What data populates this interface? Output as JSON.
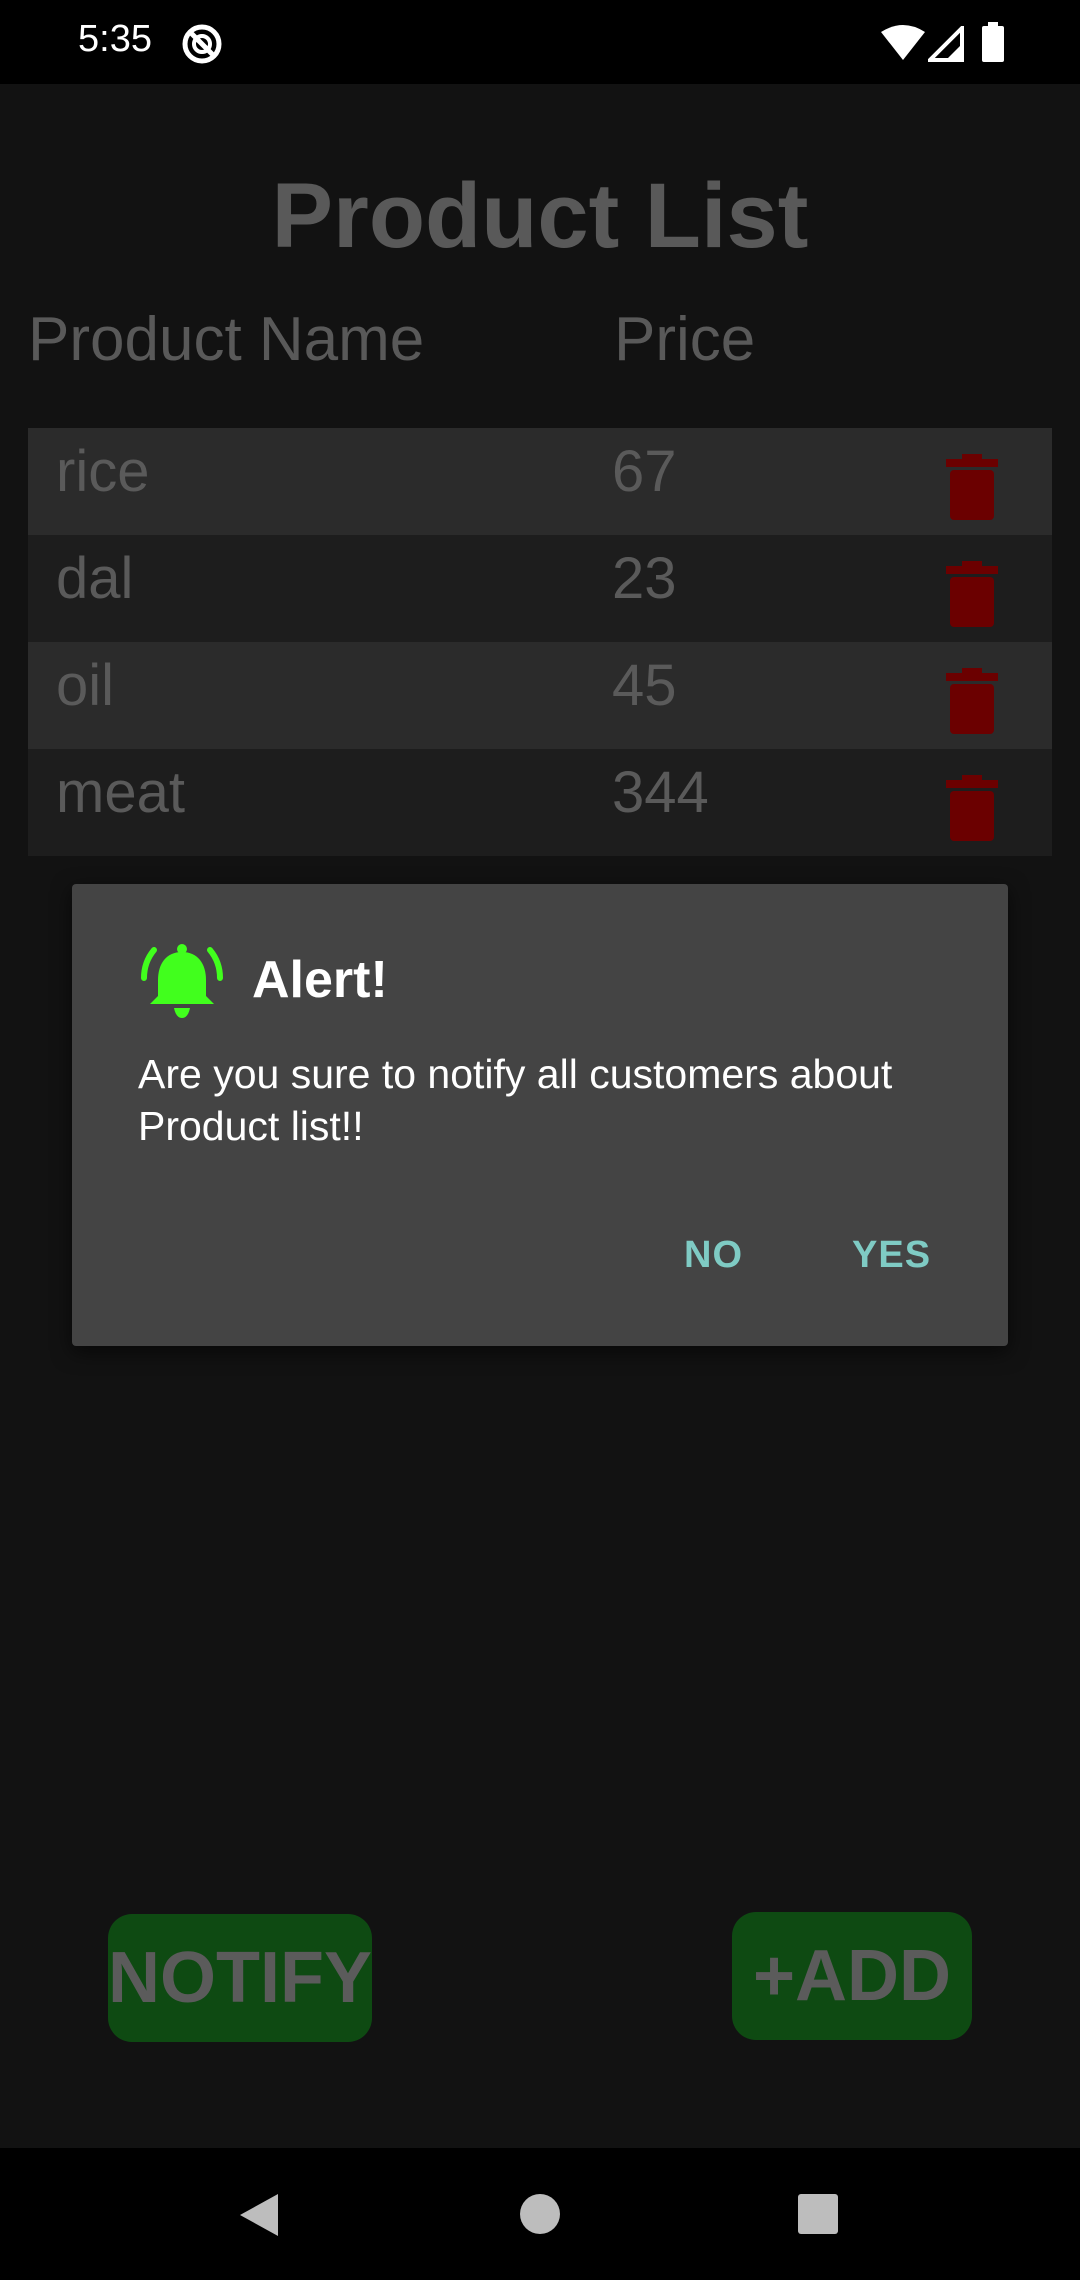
{
  "status_bar": {
    "time": "5:35"
  },
  "page": {
    "title": "Product List",
    "columns": {
      "name": "Product Name",
      "price": "Price"
    }
  },
  "products": [
    {
      "name": "rice",
      "price": "67"
    },
    {
      "name": "dal",
      "price": "23"
    },
    {
      "name": "oil",
      "price": "45"
    },
    {
      "name": "meat",
      "price": "344"
    }
  ],
  "buttons": {
    "notify": "NOTIFY",
    "add": "+ADD"
  },
  "dialog": {
    "title": "Alert!",
    "message": "Are you sure to notify all customers about Product list!!",
    "no": "NO",
    "yes": "YES",
    "icon": "alarm-bell-icon"
  },
  "colors": {
    "accent_green": "#41ff1d",
    "dialog_button": "#7fcbc4",
    "delete_red": "#6b0000",
    "button_green": "#0e4a12"
  }
}
